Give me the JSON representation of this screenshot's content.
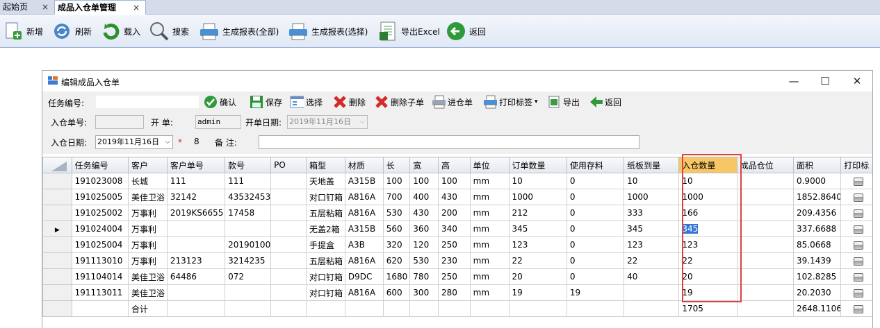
{
  "tabs": [
    {
      "label": "起始页",
      "close": "×"
    },
    {
      "label": "成品入仓单管理",
      "close": "×"
    }
  ],
  "toolbar": [
    {
      "label": "新增",
      "icon": "new-document-icon"
    },
    {
      "label": "刷新",
      "icon": "refresh-icon"
    },
    {
      "label": "载入",
      "icon": "load-icon"
    },
    {
      "label": "搜索",
      "icon": "magnifier-icon"
    },
    {
      "label": "生成报表(全部)",
      "icon": "printer-icon"
    },
    {
      "label": "生成报表(选择)",
      "icon": "printer-icon"
    },
    {
      "label": "导出Excel",
      "icon": "excel-icon"
    },
    {
      "label": "返回",
      "icon": "back-arrow-icon"
    }
  ],
  "window": {
    "title": "编辑成品入仓单",
    "minimize": "—",
    "maximize": "☐",
    "close": "✕"
  },
  "wtoolbar": {
    "task_label": "任务编号:",
    "task_value": "",
    "buttons": [
      {
        "label": "确认",
        "icon": "check-icon"
      },
      {
        "label": "保存",
        "icon": "save-icon"
      },
      {
        "label": "选择",
        "icon": "select-icon"
      },
      {
        "label": "删除",
        "icon": "delete-icon"
      },
      {
        "label": "删除子单",
        "icon": "delete-sub-icon"
      },
      {
        "label": "进仓单",
        "icon": "printer-icon"
      },
      {
        "label": "打印标签",
        "icon": "print-label-icon",
        "dropdown": "▾"
      },
      {
        "label": "导出",
        "icon": "export-icon"
      },
      {
        "label": "返回",
        "icon": "back-arrow-icon"
      }
    ]
  },
  "form": {
    "order_no_label": "入仓单号:",
    "order_no_value": "",
    "creator_label": "开    单:",
    "creator_value": "admin",
    "open_date_label": "开单日期:",
    "open_date_value": "2019年11月16日",
    "in_date_label": "入仓日期:",
    "in_date_value": "2019年11月16日",
    "required_mark": "*",
    "count": "8",
    "remark_label": "备    注:",
    "remark_value": ""
  },
  "colors": {
    "accent": "#3375d6",
    "highlight_header": "#f7c665",
    "callout": "#e04040"
  },
  "table": {
    "columns": [
      "任务编号",
      "客户",
      "客户单号",
      "款号",
      "PO",
      "箱型",
      "材质",
      "长",
      "宽",
      "高",
      "单位",
      "订单数量",
      "使用存料",
      "纸板到量",
      "入仓数量",
      "成品仓位",
      "面积",
      "打印标"
    ],
    "rows": [
      [
        "191023008",
        "长城",
        "111",
        "111",
        "",
        "天地盖",
        "A315B",
        "100",
        "100",
        "100",
        "mm",
        "10",
        "0",
        "10",
        "10",
        "",
        "0.9000"
      ],
      [
        "191025005",
        "美佳卫浴",
        "32142",
        "43532453",
        "",
        "对口钉箱",
        "A816A",
        "700",
        "400",
        "430",
        "mm",
        "1000",
        "0",
        "1000",
        "1000",
        "",
        "1852.8640"
      ],
      [
        "191025002",
        "万事利",
        "2019KS6655",
        "17458",
        "",
        "五层粘箱",
        "A816A",
        "530",
        "430",
        "200",
        "mm",
        "212",
        "0",
        "333",
        "166",
        "",
        "209.4356"
      ],
      [
        "191024004",
        "万事利",
        "",
        "",
        "",
        "无盖2箱",
        "A315B",
        "560",
        "360",
        "340",
        "mm",
        "345",
        "0",
        "345",
        "345",
        "",
        "337.6688"
      ],
      [
        "191025004",
        "万事利",
        "",
        "20190100",
        "",
        "手提盒",
        "A3B",
        "320",
        "120",
        "250",
        "mm",
        "123",
        "0",
        "123",
        "123",
        "",
        "85.0668"
      ],
      [
        "191113010",
        "万事利",
        "213123",
        "3214235",
        "",
        "五层粘箱",
        "A816A",
        "620",
        "530",
        "230",
        "mm",
        "22",
        "0",
        "22",
        "22",
        "",
        "39.1439"
      ],
      [
        "191104014",
        "美佳卫浴",
        "64486",
        "072",
        "",
        "对口钉箱",
        "D9DC",
        "1680",
        "780",
        "250",
        "mm",
        "20",
        "0",
        "40",
        "20",
        "",
        "102.8285"
      ],
      [
        "191113011",
        "美佳卫浴",
        "",
        "",
        "",
        "对口钉箱",
        "A816A",
        "600",
        "300",
        "280",
        "mm",
        "19",
        "19",
        "",
        "19",
        "",
        "20.2030"
      ]
    ],
    "current_row_marker": "▶",
    "total": {
      "label": "合计",
      "qty": "1705",
      "area": "2648.1106"
    }
  }
}
